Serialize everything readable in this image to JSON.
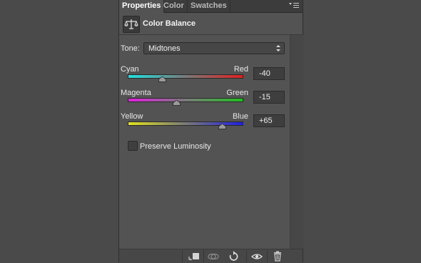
{
  "tabs": [
    {
      "label": "Properties"
    },
    {
      "label": "Color"
    },
    {
      "label": "Swatches"
    }
  ],
  "header": {
    "icon": "balance-scale-icon",
    "title": "Color Balance"
  },
  "tone": {
    "label": "Tone:",
    "value": "Midtones"
  },
  "sliders": [
    {
      "left": "Cyan",
      "right": "Red",
      "value": "-40",
      "level": -40,
      "left_color": "#20e0e0",
      "right_color": "#e02020"
    },
    {
      "left": "Magenta",
      "right": "Green",
      "value": "-15",
      "level": -15,
      "left_color": "#e020e0",
      "right_color": "#20c020"
    },
    {
      "left": "Yellow",
      "right": "Blue",
      "value": "+65",
      "level": 65,
      "left_color": "#e0e020",
      "right_color": "#2020e0"
    }
  ],
  "preserve": {
    "label": "Preserve Luminosity",
    "checked": false
  },
  "footer_icons": [
    "clip-to-layer-icon",
    "view-previous-icon",
    "reset-icon",
    "visibility-eye-icon",
    "trash-icon"
  ]
}
